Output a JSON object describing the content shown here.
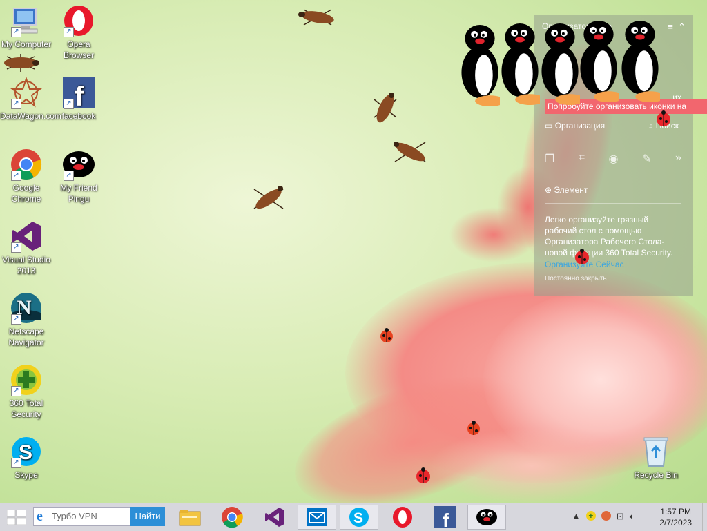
{
  "desktop": {
    "icons": [
      {
        "label": "My Computer",
        "icon": "computer-icon"
      },
      {
        "label": "Opera Browser",
        "icon": "opera-icon"
      },
      {
        "label": "DataWagon.com",
        "icon": "datawagon-icon"
      },
      {
        "label": "facebook",
        "icon": "facebook-icon"
      },
      {
        "label": "Google Chrome",
        "icon": "chrome-icon"
      },
      {
        "label": "My Friend Pingu",
        "icon": "pingu-icon"
      },
      {
        "label": "Visual Studio 2013",
        "icon": "visual-studio-icon"
      },
      {
        "label": "Netscape Navigator",
        "icon": "netscape-icon"
      },
      {
        "label": "360 Total Security",
        "icon": "360-security-icon"
      },
      {
        "label": "Skype",
        "icon": "skype-icon"
      },
      {
        "label": "Recycle Bin",
        "icon": "recycle-bin-icon"
      }
    ],
    "shortcut_glyph": "↗"
  },
  "organizer": {
    "title": "Организатор рабо",
    "tooltip": "Попробуйте организовать иконки на",
    "peek_text": "их",
    "organize_label": "Организация",
    "search_label": "Поиск",
    "element_label": "Элемент",
    "hint": "Легко организуйте грязный рабочий стол с помощью Организатора Рабочего Стола- новой функции 360 Total Security.",
    "link": "Организуйте Сейчас",
    "close": "Постоянно закрыть"
  },
  "taskbar": {
    "search_placeholder": "Турбо VPN",
    "search_button": "Найти",
    "clock_time": "1:57 PM",
    "clock_date": "2/7/2023"
  }
}
